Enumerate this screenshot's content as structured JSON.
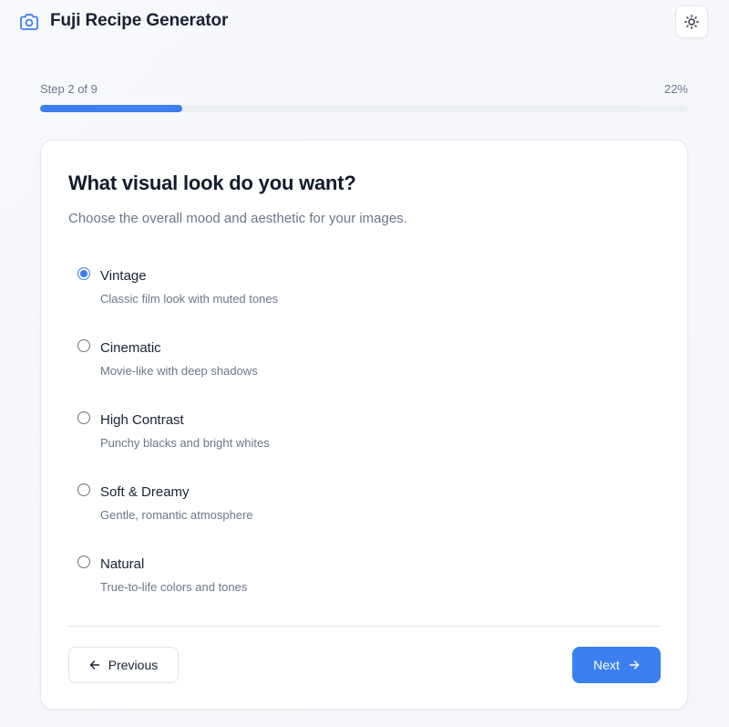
{
  "app": {
    "title": "Fuji Recipe Generator",
    "logo_icon": "camera-icon",
    "theme_toggle_icon": "sun-icon"
  },
  "progress": {
    "step_label": "Step 2 of 9",
    "percent_label": "22%",
    "fraction": 0.22
  },
  "question": {
    "title": "What visual look do you want?",
    "subtitle": "Choose the overall mood and aesthetic for your images."
  },
  "options": [
    {
      "label": "Vintage",
      "description": "Classic film look with muted tones",
      "selected": true
    },
    {
      "label": "Cinematic",
      "description": "Movie-like with deep shadows",
      "selected": false
    },
    {
      "label": "High Contrast",
      "description": "Punchy blacks and bright whites",
      "selected": false
    },
    {
      "label": "Soft & Dreamy",
      "description": "Gentle, romantic atmosphere",
      "selected": false
    },
    {
      "label": "Natural",
      "description": "True-to-life colors and tones",
      "selected": false
    }
  ],
  "nav": {
    "previous_label": "Previous",
    "previous_icon": "arrow-left-icon",
    "next_label": "Next",
    "next_icon": "arrow-right-icon"
  },
  "colors": {
    "accent": "#3b7ff0",
    "track": "#edf0f5"
  }
}
